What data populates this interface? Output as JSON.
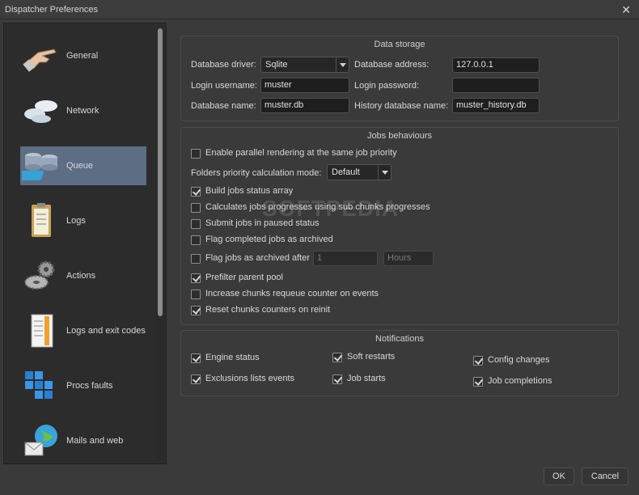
{
  "window": {
    "title": "Dispatcher Preferences",
    "close_glyph": "✕"
  },
  "sidebar": {
    "items": [
      {
        "label": "General",
        "icon": "pointing-hand-icon"
      },
      {
        "label": "Network",
        "icon": "clouds-icon"
      },
      {
        "label": "Queue",
        "icon": "database-icon",
        "active": true
      },
      {
        "label": "Logs",
        "icon": "clipboard-icon"
      },
      {
        "label": "Actions",
        "icon": "gears-icon"
      },
      {
        "label": "Logs and exit codes",
        "icon": "document-icon"
      },
      {
        "label": "Procs faults",
        "icon": "cubes-icon"
      },
      {
        "label": "Mails and web",
        "icon": "globe-mail-icon"
      }
    ]
  },
  "data_storage": {
    "title": "Data storage",
    "driver_label": "Database driver:",
    "driver_value": "Sqlite",
    "address_label": "Database address:",
    "address_value": "127.0.0.1",
    "username_label": "Login username:",
    "username_value": "muster",
    "password_label": "Login password:",
    "password_value": "",
    "dbname_label": "Database name:",
    "dbname_value": "muster.db",
    "history_label": "History database name:",
    "history_value": "muster_history.db"
  },
  "jobs": {
    "title": "Jobs behaviours",
    "parallel_rendering": {
      "label": "Enable parallel rendering at the same job priority",
      "checked": false
    },
    "folders_mode_label": "Folders priority calculation mode:",
    "folders_mode_value": "Default",
    "build_status": {
      "label": "Build jobs status array",
      "checked": true
    },
    "calc_progress": {
      "label": "Calculates jobs progresses using sub chunks progresses",
      "checked": false
    },
    "submit_paused": {
      "label": "Submit jobs in paused status",
      "checked": false
    },
    "flag_completed": {
      "label": "Flag completed jobs as archived",
      "checked": false
    },
    "flag_archived_after": {
      "label": "Flag jobs as archived after",
      "checked": false,
      "value": "1",
      "unit": "Hours"
    },
    "prefilter_pool": {
      "label": "Prefilter parent pool",
      "checked": true
    },
    "increase_requeue": {
      "label": "Increase chunks requeue counter on events",
      "checked": false
    },
    "reset_counters": {
      "label": "Reset chunks counters on reinit",
      "checked": true
    }
  },
  "notifications": {
    "title": "Notifications",
    "engine_status": {
      "label": "Engine status",
      "checked": true
    },
    "soft_restarts": {
      "label": "Soft restarts",
      "checked": true
    },
    "config_changes": {
      "label": "Config changes",
      "checked": true
    },
    "exclusions": {
      "label": "Exclusions lists events",
      "checked": true
    },
    "job_starts": {
      "label": "Job starts",
      "checked": true
    },
    "job_completions": {
      "label": "Job completions",
      "checked": true
    }
  },
  "buttons": {
    "ok": "OK",
    "cancel": "Cancel"
  },
  "watermark": "SOFTPEDIA"
}
